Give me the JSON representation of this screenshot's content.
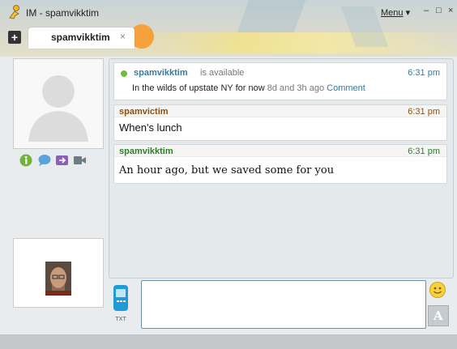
{
  "window": {
    "title": "IM - spamvikktim",
    "menu_label": "Menu",
    "menu_arrow": "▾",
    "minimize": "–",
    "restore": "□",
    "close": "×"
  },
  "tabs": {
    "add_label": "+",
    "items": [
      {
        "label": "spamvikktim",
        "close": "×"
      }
    ]
  },
  "status": {
    "name": "spamvikktim",
    "state": "is available",
    "time": "6:31 pm",
    "message": "In the wilds of upstate NY for now",
    "ago": "8d and 3h ago",
    "comment_label": "Comment"
  },
  "messages": [
    {
      "sender": "spamvictim",
      "time": "6:31 pm",
      "text": "When's lunch"
    },
    {
      "sender": "spamvikktim",
      "time": "6:31 pm",
      "text": "An hour ago, but we saved some for you"
    }
  ],
  "actions": [
    {
      "icon": "info-icon"
    },
    {
      "icon": "chat-icon"
    },
    {
      "icon": "files-icon"
    },
    {
      "icon": "video-icon"
    }
  ],
  "input": {
    "phone_label": "TXT",
    "font_label": "A"
  },
  "colors": {
    "link": "#3a7a9c",
    "self_name": "#8a4f13",
    "buddy_name": "#2f7c2d",
    "status_dot": "#6ebd3d"
  }
}
